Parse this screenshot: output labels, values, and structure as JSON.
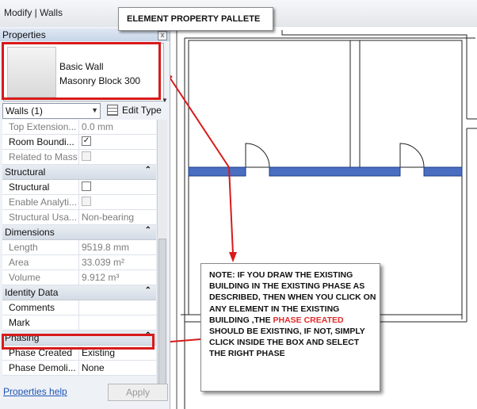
{
  "ribbon": {
    "context_tab": "Modify | Walls"
  },
  "callout": {
    "label": "ELEMENT PROPERTY PALLETE"
  },
  "properties": {
    "title": "Properties",
    "close_glyph": "x",
    "type": {
      "family": "Basic Wall",
      "name": "Masonry Block 300"
    },
    "filter": {
      "value": "Walls (1)",
      "dropdown_icon": "chevron-down-icon"
    },
    "edit_type_label": "Edit Type",
    "rows": {
      "top_extension": {
        "label": "Top Extension...",
        "value": "0.0 mm"
      },
      "room_bounding": {
        "label": "Room Boundi...",
        "checked": true
      },
      "related_to_mass": {
        "label": "Related to Mass",
        "checked": false
      },
      "structural_group": "Structural",
      "structural": {
        "label": "Structural",
        "checked": false
      },
      "enable_analytical": {
        "label": "Enable Analyti...",
        "checked": false
      },
      "structural_usage": {
        "label": "Structural Usa...",
        "value": "Non-bearing"
      },
      "dimensions_group": "Dimensions",
      "length": {
        "label": "Length",
        "value": "9519.8 mm"
      },
      "area": {
        "label": "Area",
        "value": "33.039 m²"
      },
      "volume": {
        "label": "Volume",
        "value": "9.912 m³"
      },
      "identity_group": "Identity Data",
      "comments": {
        "label": "Comments",
        "value": ""
      },
      "mark": {
        "label": "Mark",
        "value": ""
      },
      "phasing_group": "Phasing",
      "phase_created": {
        "label": "Phase Created",
        "value": "Existing"
      },
      "phase_demolished": {
        "label": "Phase Demoli...",
        "value": "None"
      }
    },
    "help_link": "Properties help",
    "apply_label": "Apply"
  },
  "note": {
    "part1": "NOTE: IF YOU DRAW THE EXISTING BUILDING IN THE EXISTING PHASE AS DESCRIBED, THEN WHEN YOU CLICK ON ANY ELEMENT IN THE EXISTING BUILDING ,THE ",
    "highlight": "PHASE CREATED",
    "part2": " SHOULD BE EXISTING, IF NOT, SIMPLY CLICK INSIDE THE BOX AND SELECT THE RIGHT PHASE"
  },
  "colors": {
    "annotation_red": "#d81a1a",
    "selected_wall": "#4a6fc0",
    "link": "#1f55b4"
  }
}
